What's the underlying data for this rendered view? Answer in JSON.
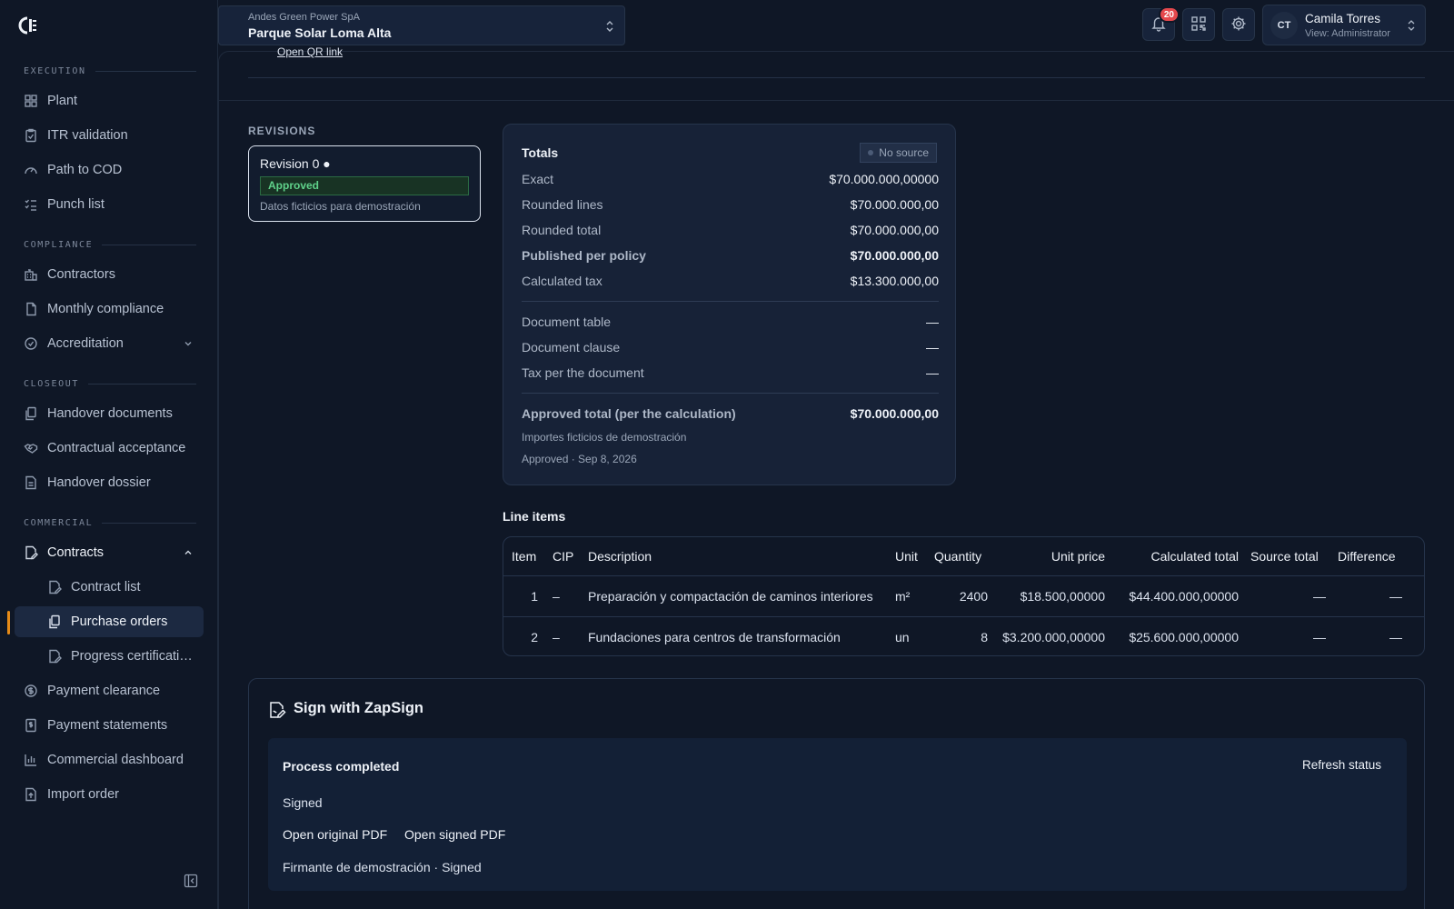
{
  "org": "Andes Green Power SpA",
  "project": "Parque Solar Loma Alta",
  "notifications_count": "20",
  "user": {
    "initials": "CT",
    "name": "Camila Torres",
    "role": "View: Administrator"
  },
  "sidebar": {
    "sections": {
      "execution": "EXECUTION",
      "compliance": "COMPLIANCE",
      "closeout": "CLOSEOUT",
      "commercial": "COMMERCIAL"
    },
    "items": {
      "plant": "Plant",
      "itr": "ITR validation",
      "path_cod": "Path to COD",
      "punch": "Punch list",
      "contractors": "Contractors",
      "monthly": "Monthly compliance",
      "accreditation": "Accreditation",
      "handover_docs": "Handover documents",
      "contractual_acceptance": "Contractual acceptance",
      "handover_dossier": "Handover dossier",
      "contracts": "Contracts",
      "contract_list": "Contract list",
      "purchase_orders": "Purchase orders",
      "progress_cert": "Progress certifications",
      "payment_clearance": "Payment clearance",
      "payment_statements": "Payment statements",
      "commercial_dashboard": "Commercial dashboard",
      "import_order": "Import order"
    }
  },
  "main": {
    "qr_link": "Open QR link",
    "revisions_title": "REVISIONS",
    "revision": {
      "name": "Revision 0 ●",
      "status": "Approved",
      "note": "Datos ficticios para demostración"
    },
    "totals": {
      "title": "Totals",
      "source_badge": "No source",
      "rows": [
        {
          "label": "Exact",
          "value": "$70.000.000,00000"
        },
        {
          "label": "Rounded lines",
          "value": "$70.000.000,00"
        },
        {
          "label": "Rounded total",
          "value": "$70.000.000,00"
        },
        {
          "label": "Published per policy",
          "value": "$70.000.000,00"
        },
        {
          "label": "Calculated tax",
          "value": "$13.300.000,00"
        },
        {
          "label": "Document table",
          "value": "—"
        },
        {
          "label": "Document clause",
          "value": "—"
        },
        {
          "label": "Tax per the document",
          "value": "—"
        },
        {
          "label": "Approved total (per the calculation)",
          "value": "$70.000.000,00"
        }
      ],
      "note1": "Importes ficticios de demostración",
      "note2": "Approved · Sep 8, 2026"
    },
    "line_items_title": "Line items",
    "line_items": {
      "headers": [
        "Item",
        "CIP",
        "Description",
        "Unit",
        "Quantity",
        "Unit price",
        "Calculated total",
        "Source total",
        "Difference"
      ],
      "rows": [
        [
          "1",
          "–",
          "Preparación y compactación de caminos interiores",
          "m²",
          "2400",
          "$18.500,00000",
          "$44.400.000,00000",
          "—",
          "—"
        ],
        [
          "2",
          "–",
          "Fundaciones para centros de transformación",
          "un",
          "8",
          "$3.200.000,00000",
          "$25.600.000,00000",
          "—",
          "—"
        ]
      ]
    },
    "zapsign": {
      "title": "Sign with ZapSign",
      "status": "Process completed",
      "refresh": "Refresh status",
      "signed": "Signed",
      "open_original": "Open original PDF",
      "open_signed": "Open signed PDF",
      "signer": "Firmante de demostración · Signed"
    }
  },
  "colors": {
    "background": "#0f1726",
    "card": "#172237",
    "accent": "#e58a17",
    "approved_green": "#5fd18a",
    "badge_red": "#e5484d"
  }
}
